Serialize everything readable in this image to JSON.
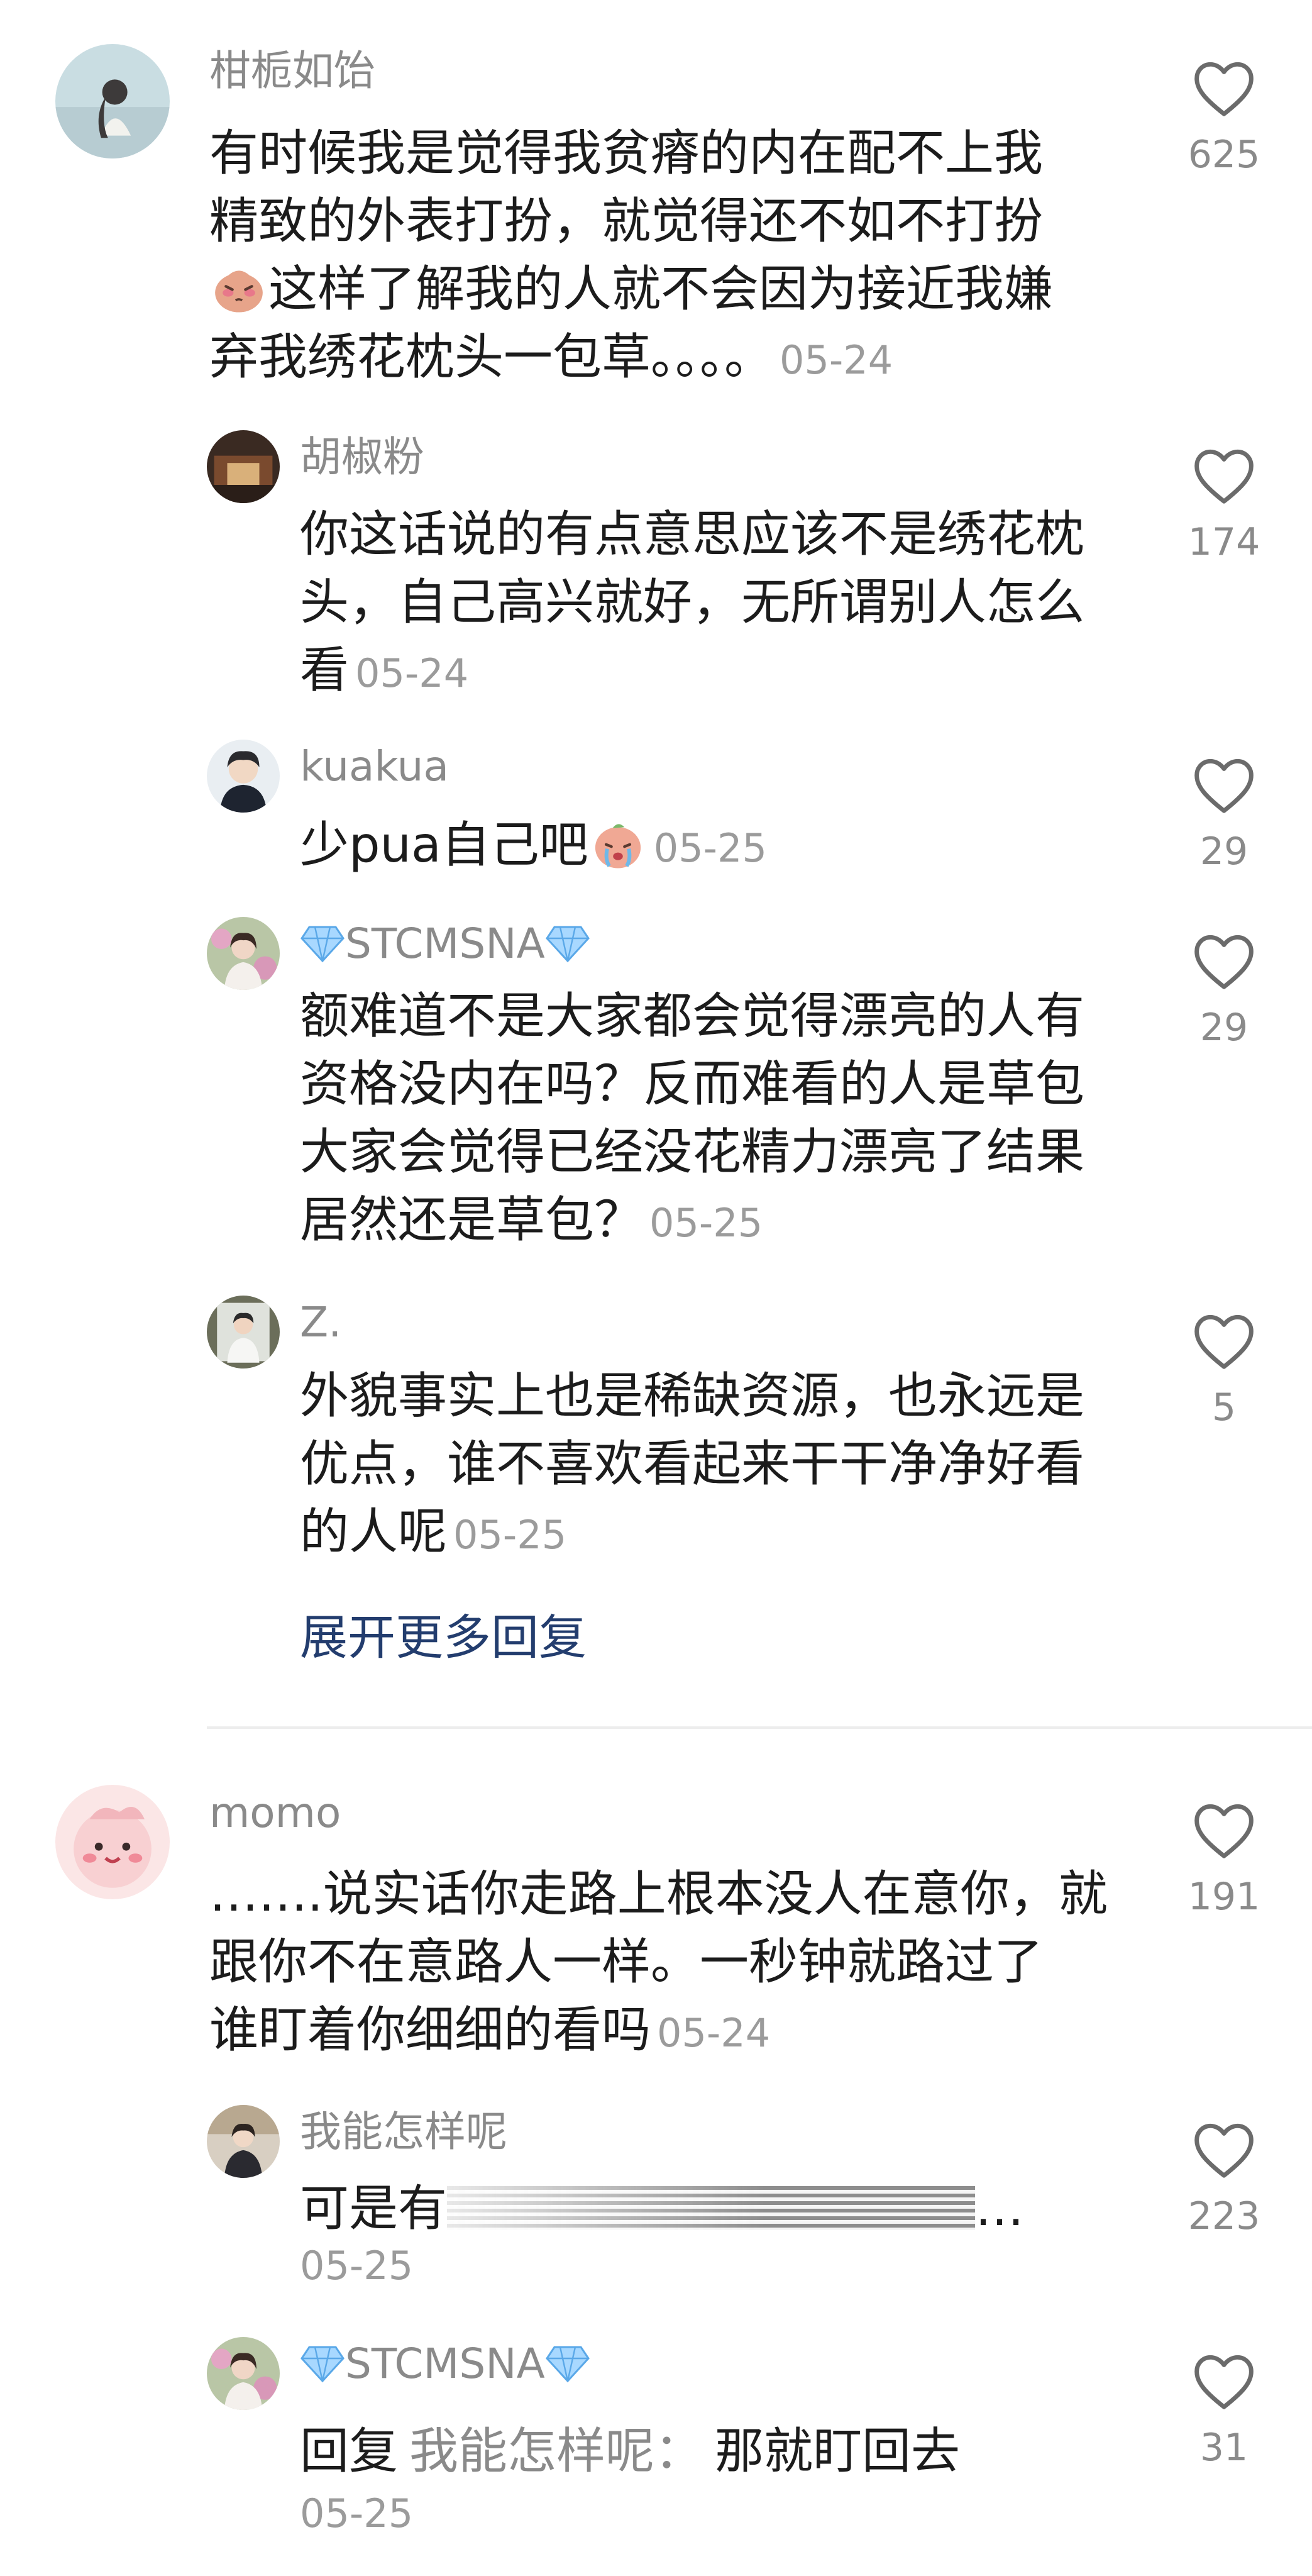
{
  "comments": [
    {
      "user": "柑栀如饴",
      "lines": [
        "有时候我是觉得我贫瘠的内在配不上我",
        "精致的外表打扮，就觉得还不如不打扮",
        "这样了解我的人就不会因为接近我嫌",
        "弃我绣花枕头一包草。。。。"
      ],
      "date": "05-24",
      "likes": "625",
      "replies": [
        {
          "user": "胡椒粉",
          "lines": [
            "你这话说的有点意思应该不是绣花枕",
            "头，自己高兴就好，无所谓别人怎么",
            "看"
          ],
          "date": "05-24",
          "likes": "174"
        },
        {
          "user": "kuakua",
          "lines": [
            "少pua自己吧"
          ],
          "date": "05-25",
          "likes": "29"
        },
        {
          "user": "STCMSNA",
          "lines": [
            "额难道不是大家都会觉得漂亮的人有",
            "资格没内在吗？反而难看的人是草包",
            "大家会觉得已经没花精力漂亮了结果",
            "居然还是草包？"
          ],
          "date": "05-25",
          "likes": "29"
        },
        {
          "user": "Z.",
          "lines": [
            "外貌事实上也是稀缺资源，也永远是",
            "优点，谁不喜欢看起来干干净净好看",
            "的人呢"
          ],
          "date": "05-25",
          "likes": "5"
        }
      ],
      "expand_label": "展开更多回复"
    },
    {
      "user": "momo",
      "lines": [
        "…….说实话你走路上根本没人在意你，就",
        "跟你不在意路人一样。一秒钟就路过了",
        "谁盯着你细细的看吗"
      ],
      "date": "05-24",
      "likes": "191",
      "replies": [
        {
          "user": "我能怎样呢",
          "lines": [
            "可是有"
          ],
          "ellipsis": "…",
          "date": "05-25",
          "likes": "223"
        },
        {
          "user": "STCMSNA",
          "reply_word": "回复",
          "reply_to": "我能怎样呢：",
          "text": "那就盯回去",
          "date": "05-25",
          "likes": "31"
        }
      ]
    }
  ],
  "icons": {
    "like": "heart-outline-icon",
    "gem": "gem-icon",
    "emoji": "blush-emoji-icon"
  },
  "colors": {
    "link": "#233d6e",
    "meta": "#8a8a8a",
    "text": "#1c1c1c"
  }
}
